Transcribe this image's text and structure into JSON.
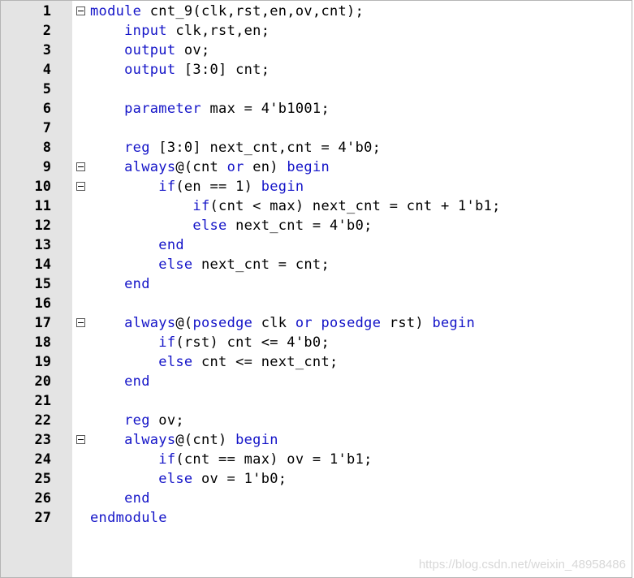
{
  "colors": {
    "keyword": "#1414c8",
    "text": "#000000",
    "gutter": "#e4e4e4"
  },
  "editor": {
    "lines": [
      {
        "number": "1",
        "fold": true,
        "tokens": [
          {
            "t": "module",
            "kw": true
          },
          {
            "t": " cnt_9(clk,rst,en,ov,cnt);"
          }
        ]
      },
      {
        "number": "2",
        "fold": false,
        "tokens": [
          {
            "t": "    "
          },
          {
            "t": "input",
            "kw": true
          },
          {
            "t": " clk,rst,en;"
          }
        ]
      },
      {
        "number": "3",
        "fold": false,
        "tokens": [
          {
            "t": "    "
          },
          {
            "t": "output",
            "kw": true
          },
          {
            "t": " ov;"
          }
        ]
      },
      {
        "number": "4",
        "fold": false,
        "tokens": [
          {
            "t": "    "
          },
          {
            "t": "output",
            "kw": true
          },
          {
            "t": " [3:0] cnt;"
          }
        ]
      },
      {
        "number": "5",
        "fold": false,
        "tokens": []
      },
      {
        "number": "6",
        "fold": false,
        "tokens": [
          {
            "t": "    "
          },
          {
            "t": "parameter",
            "kw": true
          },
          {
            "t": " max = 4'b1001;"
          }
        ]
      },
      {
        "number": "7",
        "fold": false,
        "tokens": []
      },
      {
        "number": "8",
        "fold": false,
        "tokens": [
          {
            "t": "    "
          },
          {
            "t": "reg",
            "kw": true
          },
          {
            "t": " [3:0] next_cnt,cnt = 4'b0;"
          }
        ]
      },
      {
        "number": "9",
        "fold": true,
        "tokens": [
          {
            "t": "    "
          },
          {
            "t": "always",
            "kw": true
          },
          {
            "t": "@(cnt "
          },
          {
            "t": "or",
            "kw": true
          },
          {
            "t": " en) "
          },
          {
            "t": "begin",
            "kw": true
          }
        ]
      },
      {
        "number": "10",
        "fold": true,
        "tokens": [
          {
            "t": "        "
          },
          {
            "t": "if",
            "kw": true
          },
          {
            "t": "(en == 1) "
          },
          {
            "t": "begin",
            "kw": true
          }
        ]
      },
      {
        "number": "11",
        "fold": false,
        "tokens": [
          {
            "t": "            "
          },
          {
            "t": "if",
            "kw": true
          },
          {
            "t": "(cnt < max) next_cnt = cnt + 1'b1;"
          }
        ]
      },
      {
        "number": "12",
        "fold": false,
        "tokens": [
          {
            "t": "            "
          },
          {
            "t": "else",
            "kw": true
          },
          {
            "t": " next_cnt = 4'b0;"
          }
        ]
      },
      {
        "number": "13",
        "fold": false,
        "tokens": [
          {
            "t": "        "
          },
          {
            "t": "end",
            "kw": true
          }
        ]
      },
      {
        "number": "14",
        "fold": false,
        "tokens": [
          {
            "t": "        "
          },
          {
            "t": "else",
            "kw": true
          },
          {
            "t": " next_cnt = cnt;"
          }
        ]
      },
      {
        "number": "15",
        "fold": false,
        "tokens": [
          {
            "t": "    "
          },
          {
            "t": "end",
            "kw": true
          }
        ]
      },
      {
        "number": "16",
        "fold": false,
        "tokens": []
      },
      {
        "number": "17",
        "fold": true,
        "tokens": [
          {
            "t": "    "
          },
          {
            "t": "always",
            "kw": true
          },
          {
            "t": "@("
          },
          {
            "t": "posedge",
            "kw": true
          },
          {
            "t": " clk "
          },
          {
            "t": "or",
            "kw": true
          },
          {
            "t": " "
          },
          {
            "t": "posedge",
            "kw": true
          },
          {
            "t": " rst) "
          },
          {
            "t": "begin",
            "kw": true
          }
        ]
      },
      {
        "number": "18",
        "fold": false,
        "tokens": [
          {
            "t": "        "
          },
          {
            "t": "if",
            "kw": true
          },
          {
            "t": "(rst) cnt <= 4'b0;"
          }
        ]
      },
      {
        "number": "19",
        "fold": false,
        "tokens": [
          {
            "t": "        "
          },
          {
            "t": "else",
            "kw": true
          },
          {
            "t": " cnt <= next_cnt;"
          }
        ]
      },
      {
        "number": "20",
        "fold": false,
        "tokens": [
          {
            "t": "    "
          },
          {
            "t": "end",
            "kw": true
          }
        ]
      },
      {
        "number": "21",
        "fold": false,
        "tokens": []
      },
      {
        "number": "22",
        "fold": false,
        "tokens": [
          {
            "t": "    "
          },
          {
            "t": "reg",
            "kw": true
          },
          {
            "t": " ov;"
          }
        ]
      },
      {
        "number": "23",
        "fold": true,
        "tokens": [
          {
            "t": "    "
          },
          {
            "t": "always",
            "kw": true
          },
          {
            "t": "@(cnt) "
          },
          {
            "t": "begin",
            "kw": true
          }
        ]
      },
      {
        "number": "24",
        "fold": false,
        "tokens": [
          {
            "t": "        "
          },
          {
            "t": "if",
            "kw": true
          },
          {
            "t": "(cnt == max) ov = 1'b1;"
          }
        ]
      },
      {
        "number": "25",
        "fold": false,
        "tokens": [
          {
            "t": "        "
          },
          {
            "t": "else",
            "kw": true
          },
          {
            "t": " ov = 1'b0;"
          }
        ]
      },
      {
        "number": "26",
        "fold": false,
        "tokens": [
          {
            "t": "    "
          },
          {
            "t": "end",
            "kw": true
          }
        ]
      },
      {
        "number": "27",
        "fold": false,
        "tokens": [
          {
            "t": "endmodule",
            "kw": true
          }
        ]
      }
    ]
  },
  "watermark": "https://blog.csdn.net/weixin_48958486"
}
